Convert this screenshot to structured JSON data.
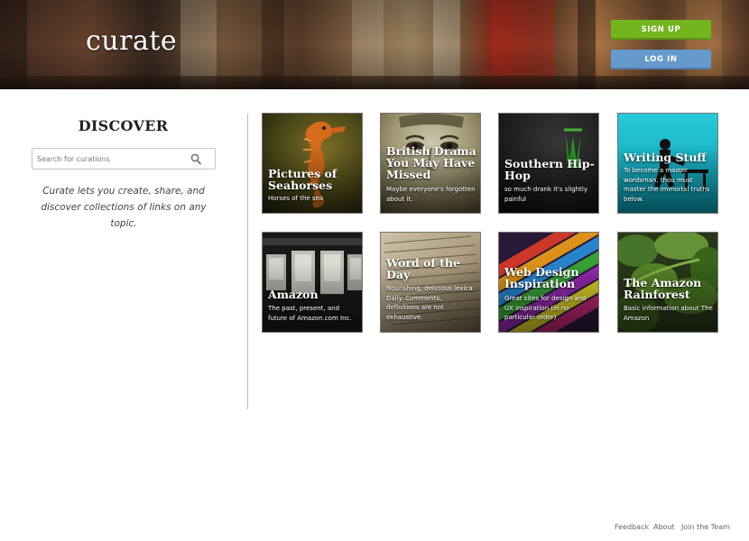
{
  "header": {
    "logo": "curate",
    "signup_label": "SIGN UP",
    "login_label": "LOG IN"
  },
  "sidebar": {
    "title": "DISCOVER",
    "search_placeholder": "Search for curations",
    "search_icon": "search-icon",
    "tagline": "Curate lets you create, share, and discover collections of links on any topic."
  },
  "cards": [
    {
      "title": "Pictures of Seahorses",
      "desc": "Horses of the sea"
    },
    {
      "title": "British Drama You May Have Missed",
      "desc": "Maybe everyone's forgotten about it."
    },
    {
      "title": "Southern Hip-Hop",
      "desc": "so much drank it's slightly painful"
    },
    {
      "title": "Writing Stuff",
      "desc": "To become a master wordsman, thou must master the immortal truths below."
    },
    {
      "title": "Amazon",
      "desc": "The past, present, and future of Amazon.com Inc."
    },
    {
      "title": "Word of the Day",
      "desc": "Nourishing, delicious lexica. Daily. Comments, definitions are not exhaustive."
    },
    {
      "title": "Web Design Inspiration",
      "desc": "Great sites for design and UX inspiration (in no particular order)"
    },
    {
      "title": "The Amazon Rainforest",
      "desc": "Basic information about The Amazon"
    }
  ],
  "footer": {
    "links": [
      "Feedback",
      "About",
      "Join the Team"
    ]
  },
  "colors": {
    "signup": "#72b51f",
    "login": "#6699cc",
    "divider": "#bdbdbd"
  }
}
